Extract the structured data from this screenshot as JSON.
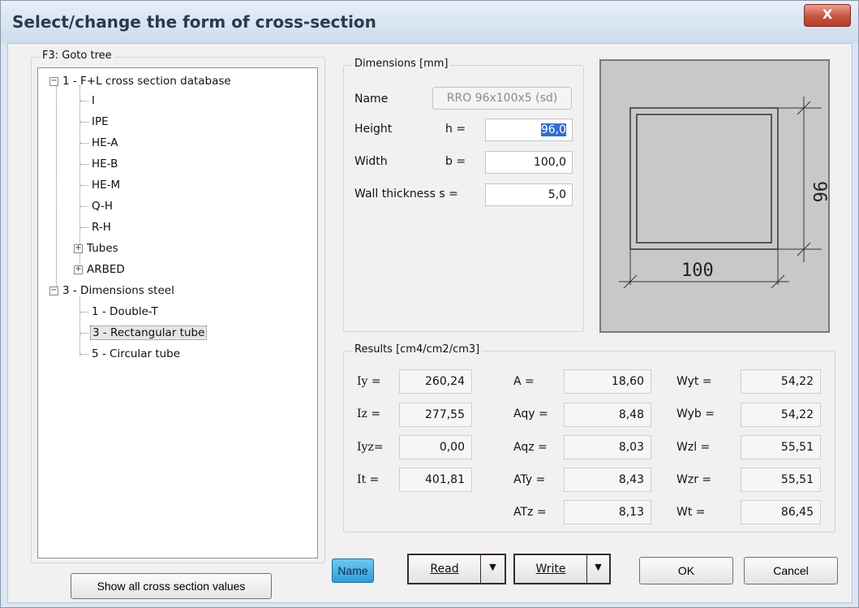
{
  "window": {
    "title": "Select/change the form of cross-section",
    "close_glyph": "X"
  },
  "tree": {
    "group_label": "F3: Goto tree",
    "nodes": [
      {
        "label": "1 - F+L cross section database",
        "expander": "−"
      },
      {
        "label": "I"
      },
      {
        "label": "IPE"
      },
      {
        "label": "HE-A"
      },
      {
        "label": "HE-B"
      },
      {
        "label": "HE-M"
      },
      {
        "label": "Q-H"
      },
      {
        "label": "R-H"
      },
      {
        "label": "Tubes",
        "expander": "+"
      },
      {
        "label": "ARBED",
        "expander": "+"
      },
      {
        "label": "3 - Dimensions steel",
        "expander": "−"
      },
      {
        "label": "1 - Double-T"
      },
      {
        "label": "3 - Rectangular tube",
        "selected": true
      },
      {
        "label": "5 - Circular tube"
      }
    ]
  },
  "dimensions": {
    "group_label": "Dimensions [mm]",
    "name_label": "Name",
    "name_value": "RRO 96x100x5 (sd)",
    "height_label": "Height",
    "height_sym": "h  =",
    "height_value": "96,0",
    "width_label": "Width",
    "width_sym": "b  =",
    "width_value": "100,0",
    "wall_label": "Wall thickness s  =",
    "wall_value": "5,0"
  },
  "preview": {
    "dim_h": "96",
    "dim_b": "100"
  },
  "results": {
    "group_label": "Results  [cm4/cm2/cm3]",
    "col1": [
      {
        "label": "Iy  =",
        "value": "260,24"
      },
      {
        "label": "Iz  =",
        "value": "277,55"
      },
      {
        "label": "Iyz=",
        "value": "0,00"
      },
      {
        "label": "It  =",
        "value": "401,81"
      }
    ],
    "col2": [
      {
        "label": "A      =",
        "value": "18,60"
      },
      {
        "label": "Aqy  =",
        "value": "8,48"
      },
      {
        "label": "Aqz  =",
        "value": "8,03"
      },
      {
        "label": "ATy  =",
        "value": "8,43"
      },
      {
        "label": "ATz  =",
        "value": "8,13"
      }
    ],
    "col3": [
      {
        "label": "Wyt  =",
        "value": "54,22"
      },
      {
        "label": "Wyb  =",
        "value": "54,22"
      },
      {
        "label": "Wzl   =",
        "value": "55,51"
      },
      {
        "label": "Wzr   =",
        "value": "55,51"
      },
      {
        "label": "Wt     =",
        "value": "86,45"
      }
    ]
  },
  "buttons": {
    "show_all": "Show all cross section values",
    "name": "Name",
    "read": "Read",
    "write": "Write",
    "dropdown_glyph": "▼",
    "ok": "OK",
    "cancel": "Cancel"
  }
}
